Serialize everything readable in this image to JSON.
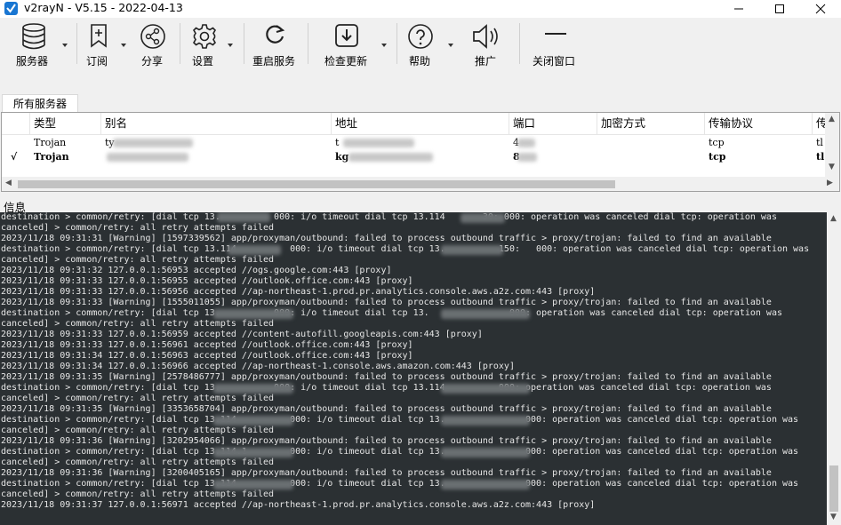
{
  "window": {
    "title": "v2rayN - V5.15 - 2022-04-13"
  },
  "toolbar": {
    "items": [
      {
        "label": "服务器",
        "icon": "server-stack-icon",
        "dropdown": true
      },
      {
        "label": "订阅",
        "icon": "bookmark-plus-icon",
        "dropdown": true
      },
      {
        "label": "分享",
        "icon": "share-icon",
        "dropdown": false
      },
      {
        "label": "设置",
        "icon": "gear-icon",
        "dropdown": true
      },
      {
        "label": "重启服务",
        "icon": "restart-icon",
        "dropdown": false
      },
      {
        "label": "检查更新",
        "icon": "download-icon",
        "dropdown": true
      },
      {
        "label": "帮助",
        "icon": "help-icon",
        "dropdown": true
      },
      {
        "label": "推广",
        "icon": "speaker-icon",
        "dropdown": false
      },
      {
        "label": "关闭窗口",
        "icon": "minimize-line-icon",
        "dropdown": false
      }
    ]
  },
  "tabs": {
    "active": "所有服务器"
  },
  "servers": {
    "columns": [
      "类型",
      "别名",
      "地址",
      "端口",
      "加密方式",
      "传输协议",
      "传"
    ],
    "rows": [
      {
        "active": false,
        "type": "Trojan",
        "alias": "ty",
        "address": "t",
        "port": "4",
        "protocol": "tcp",
        "tls": "tl"
      },
      {
        "active": true,
        "check": "√",
        "type": "Trojan",
        "alias": "",
        "address": "kg",
        "port": "8",
        "protocol": "tcp",
        "tls": "tl"
      }
    ]
  },
  "info": {
    "label": "信息"
  },
  "log_lines": [
    "destination > common/retry: [dial tcp 13.          000: i/o timeout dial tcp 13.114       30: 000: operation was canceled dial tcp: operation was",
    "canceled] > common/retry: all retry attempts failed",
    "2023/11/18 09:31:31 [Warning] [1597339562] app/proxyman/outbound: failed to process outbound traffic > proxy/trojan: failed to find an available",
    "destination > common/retry: [dial tcp 13.114          000: i/o timeout dial tcp 13.          150:   000: operation was canceled dial tcp: operation was",
    "canceled] > common/retry: all retry attempts failed",
    "2023/11/18 09:31:32 127.0.0.1:56953 accepted //ogs.google.com:443 [proxy]",
    "2023/11/18 09:31:33 127.0.0.1:56955 accepted //outlook.office.com:443 [proxy]",
    "2023/11/18 09:31:33 127.0.0.1:56956 accepted //ap-northeast-1.prod.pr.analytics.console.aws.a2z.com:443 [proxy]",
    "2023/11/18 09:31:33 [Warning] [1555011055] app/proxyman/outbound: failed to process outbound traffic > proxy/trojan: failed to find an available",
    "destination > common/retry: [dial tcp 13.          000: i/o timeout dial tcp 13.               000: operation was canceled dial tcp: operation was",
    "canceled] > common/retry: all retry attempts failed",
    "2023/11/18 09:31:33 127.0.0.1:56959 accepted //content-autofill.googleapis.com:443 [proxy]",
    "2023/11/18 09:31:33 127.0.0.1:56961 accepted //outlook.office.com:443 [proxy]",
    "2023/11/18 09:31:34 127.0.0.1:56963 accepted //outlook.office.com:443 [proxy]",
    "2023/11/18 09:31:34 127.0.0.1:56966 accepted //ap-northeast-1.console.aws.amazon.com:443 [proxy]",
    "2023/11/18 09:31:35 [Warning] [2578486777] app/proxyman/outbound: failed to process outbound traffic > proxy/trojan: failed to find an available",
    "destination > common/retry: [dial tcp 13.          000: i/o timeout dial tcp 13.114          000: operation was canceled dial tcp: operation was",
    "canceled] > common/retry: all retry attempts failed",
    "2023/11/18 09:31:35 [Warning] [3353658704] app/proxyman/outbound: failed to process outbound traffic > proxy/trojan: failed to find an available",
    "destination > common/retry: [dial tcp 13.114          000: i/o timeout dial tcp 13.               000: operation was canceled dial tcp: operation was",
    "canceled] > common/retry: all retry attempts failed",
    "2023/11/18 09:31:36 [Warning] [3202954066] app/proxyman/outbound: failed to process outbound traffic > proxy/trojan: failed to find an available",
    "destination > common/retry: [dial tcp 13.114.1        000: i/o timeout dial tcp 13.               000: operation was canceled dial tcp: operation was",
    "canceled] > common/retry: all retry attempts failed",
    "2023/11/18 09:31:36 [Warning] [3200405165] app/proxyman/outbound: failed to process outbound traffic > proxy/trojan: failed to find an available",
    "destination > common/retry: [dial tcp 13.114          000: i/o timeout dial tcp 13.               000: operation was canceled dial tcp: operation was",
    "canceled] > common/retry: all retry attempts failed",
    "2023/11/18 09:31:37 127.0.0.1:56971 accepted //ap-northeast-1.prod.pr.analytics.console.aws.a2z.com:443 [proxy]"
  ],
  "colors": {
    "console_bg": "#2b3033",
    "console_text": "#e6e6e6",
    "app_icon": "#1976d2"
  }
}
